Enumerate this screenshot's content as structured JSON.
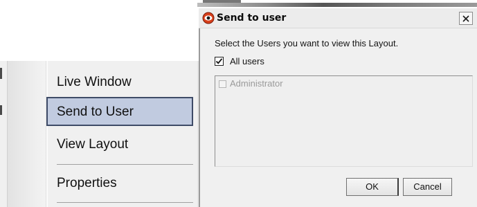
{
  "context_menu": {
    "items": [
      {
        "label": "Live Window",
        "selected": false
      },
      {
        "label": "Send to User",
        "selected": true
      },
      {
        "label": "View Layout",
        "selected": false
      },
      {
        "label": "Properties",
        "selected": false
      }
    ],
    "selection_color": "#c1cbe0",
    "selection_border_color": "#3e4b67"
  },
  "dialog": {
    "title": "Send to user",
    "app_icon": "red-eye-icon",
    "close_icon": "close-x-icon",
    "prompt": "Select the Users you want to view this Layout.",
    "all_users": {
      "label": "All users",
      "checked": true
    },
    "users": [
      {
        "label": "Administrator",
        "checked": false,
        "enabled": false
      }
    ],
    "ok_label": "OK",
    "cancel_label": "Cancel"
  }
}
